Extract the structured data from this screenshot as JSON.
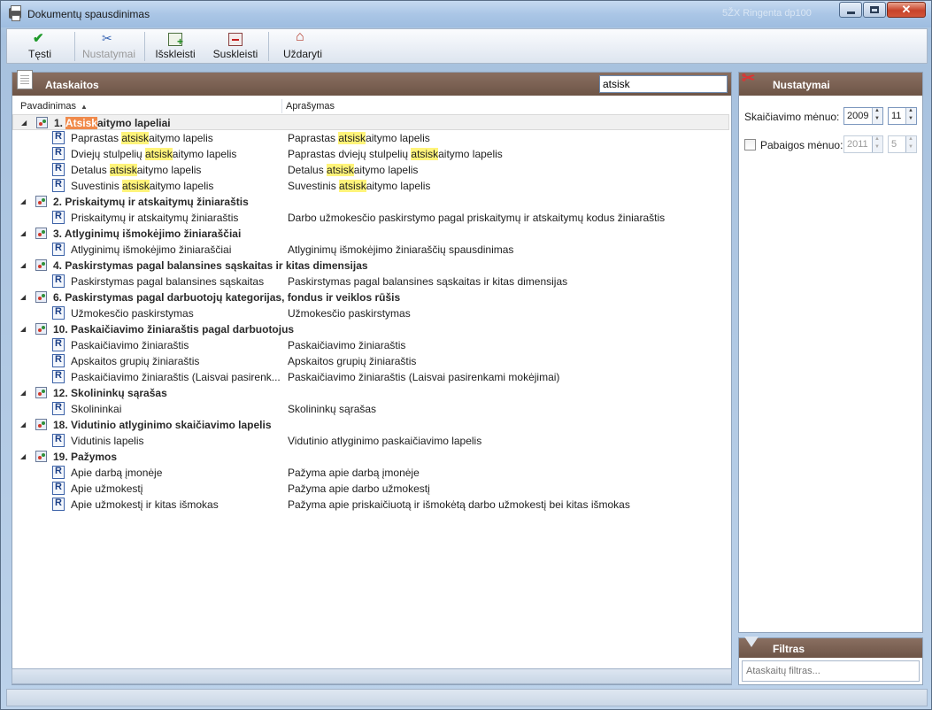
{
  "window": {
    "title": "Dokumentų spausdinimas",
    "background_ghost_text": "5ŽX Ringenta dp100"
  },
  "toolbar": {
    "continue_label": "Tęsti",
    "settings_label": "Nustatymai",
    "expand_label": "Išskleisti",
    "collapse_label": "Suskleisti",
    "close_label": "Uždaryti"
  },
  "reports_panel": {
    "title": "Ataskaitos",
    "search_value": "atsisk",
    "columns": {
      "name": "Pavadinimas",
      "description": "Aprašymas"
    }
  },
  "groups": [
    {
      "pre": "1. ",
      "hl": "Atsisk",
      "post": "aitymo lapeliai",
      "items": [
        {
          "name": {
            "pre": "Paprastas ",
            "hl": "atsisk",
            "post": "aitymo lapelis"
          },
          "desc": {
            "pre": "Paprastas ",
            "hl": "atsisk",
            "post": "aitymo lapelis"
          }
        },
        {
          "name": {
            "pre": "Dviejų stulpelių ",
            "hl": "atsisk",
            "post": "aitymo lapelis"
          },
          "desc": {
            "pre": "Paprastas dviejų stulpelių ",
            "hl": "atsisk",
            "post": "aitymo lapelis"
          }
        },
        {
          "name": {
            "pre": "Detalus ",
            "hl": "atsisk",
            "post": "aitymo lapelis"
          },
          "desc": {
            "pre": "Detalus ",
            "hl": "atsisk",
            "post": "aitymo lapelis"
          }
        },
        {
          "name": {
            "pre": "Suvestinis ",
            "hl": "atsisk",
            "post": "aitymo lapelis"
          },
          "desc": {
            "pre": "Suvestinis ",
            "hl": "atsisk",
            "post": "aitymo lapelis"
          }
        }
      ]
    },
    {
      "pre": "2. Priskaitymų ir atskaitymų žiniaraštis",
      "hl": "",
      "post": "",
      "items": [
        {
          "name": {
            "pre": "Priskaitymų ir atskaitymų žiniaraštis",
            "hl": "",
            "post": ""
          },
          "desc": {
            "pre": "Darbo užmokesčio paskirstymo pagal priskaitymų ir atskaitymų kodus žiniaraštis",
            "hl": "",
            "post": ""
          }
        }
      ]
    },
    {
      "pre": "3. Atlyginimų išmokėjimo žiniaraščiai",
      "hl": "",
      "post": "",
      "items": [
        {
          "name": {
            "pre": "Atlyginimų išmokėjimo žiniaraščiai",
            "hl": "",
            "post": ""
          },
          "desc": {
            "pre": "Atlyginimų išmokėjimo žiniaraščių spausdinimas",
            "hl": "",
            "post": ""
          }
        }
      ]
    },
    {
      "pre": "4. Paskirstymas pagal balansines sąskaitas ir kitas dimensijas",
      "hl": "",
      "post": "",
      "items": [
        {
          "name": {
            "pre": "Paskirstymas pagal balansines sąskaitas",
            "hl": "",
            "post": ""
          },
          "desc": {
            "pre": "Paskirstymas pagal balansines sąskaitas ir kitas dimensijas",
            "hl": "",
            "post": ""
          }
        }
      ]
    },
    {
      "pre": "6. Paskirstymas pagal darbuotojų kategorijas, fondus ir veiklos rūšis",
      "hl": "",
      "post": "",
      "items": [
        {
          "name": {
            "pre": "Užmokesčio paskirstymas",
            "hl": "",
            "post": ""
          },
          "desc": {
            "pre": "Užmokesčio paskirstymas",
            "hl": "",
            "post": ""
          }
        }
      ]
    },
    {
      "pre": "10. Paskaičiavimo žiniaraštis pagal darbuotojus",
      "hl": "",
      "post": "",
      "items": [
        {
          "name": {
            "pre": "Paskaičiavimo žiniaraštis",
            "hl": "",
            "post": ""
          },
          "desc": {
            "pre": "Paskaičiavimo žiniaraštis",
            "hl": "",
            "post": ""
          }
        },
        {
          "name": {
            "pre": "Apskaitos grupių žiniaraštis",
            "hl": "",
            "post": ""
          },
          "desc": {
            "pre": "Apskaitos grupių žiniaraštis",
            "hl": "",
            "post": ""
          }
        },
        {
          "name": {
            "pre": "Paskaičiavimo žiniaraštis  (Laisvai pasirenk...",
            "hl": "",
            "post": ""
          },
          "desc": {
            "pre": "Paskaičiavimo žiniaraštis (Laisvai pasirenkami mokėjimai)",
            "hl": "",
            "post": ""
          }
        }
      ]
    },
    {
      "pre": "12. Skolininkų sąrašas",
      "hl": "",
      "post": "",
      "items": [
        {
          "name": {
            "pre": "Skolininkai",
            "hl": "",
            "post": ""
          },
          "desc": {
            "pre": "Skolininkų sąrašas",
            "hl": "",
            "post": ""
          }
        }
      ]
    },
    {
      "pre": "18. Vidutinio atlyginimo skaičiavimo lapelis",
      "hl": "",
      "post": "",
      "items": [
        {
          "name": {
            "pre": "Vidutinis lapelis",
            "hl": "",
            "post": ""
          },
          "desc": {
            "pre": "Vidutinio atlyginimo paskaičiavimo lapelis",
            "hl": "",
            "post": ""
          }
        }
      ]
    },
    {
      "pre": "19. Pažymos",
      "hl": "",
      "post": "",
      "items": [
        {
          "name": {
            "pre": "Apie darbą įmonėje",
            "hl": "",
            "post": ""
          },
          "desc": {
            "pre": "Pažyma apie darbą įmonėje",
            "hl": "",
            "post": ""
          }
        },
        {
          "name": {
            "pre": "Apie užmokestį",
            "hl": "",
            "post": ""
          },
          "desc": {
            "pre": "Pažyma apie darbo užmokestį",
            "hl": "",
            "post": ""
          }
        },
        {
          "name": {
            "pre": "Apie užmokestį ir kitas išmokas",
            "hl": "",
            "post": ""
          },
          "desc": {
            "pre": "Pažyma apie priskaičiuotą ir išmokėtą darbo užmokestį bei kitas išmokas",
            "hl": "",
            "post": ""
          }
        }
      ]
    }
  ],
  "settings_panel": {
    "title": "Nustatymai",
    "calc_month_label": "Skaičiavimo mėnuo:",
    "calc_year": "2009",
    "calc_month": "11",
    "end_month_label": "Pabaigos mėnuo:",
    "end_year": "2011",
    "end_month": "5",
    "end_month_checked": false
  },
  "filter_panel": {
    "title": "Filtras",
    "placeholder": "Ataskaitų filtras..."
  }
}
